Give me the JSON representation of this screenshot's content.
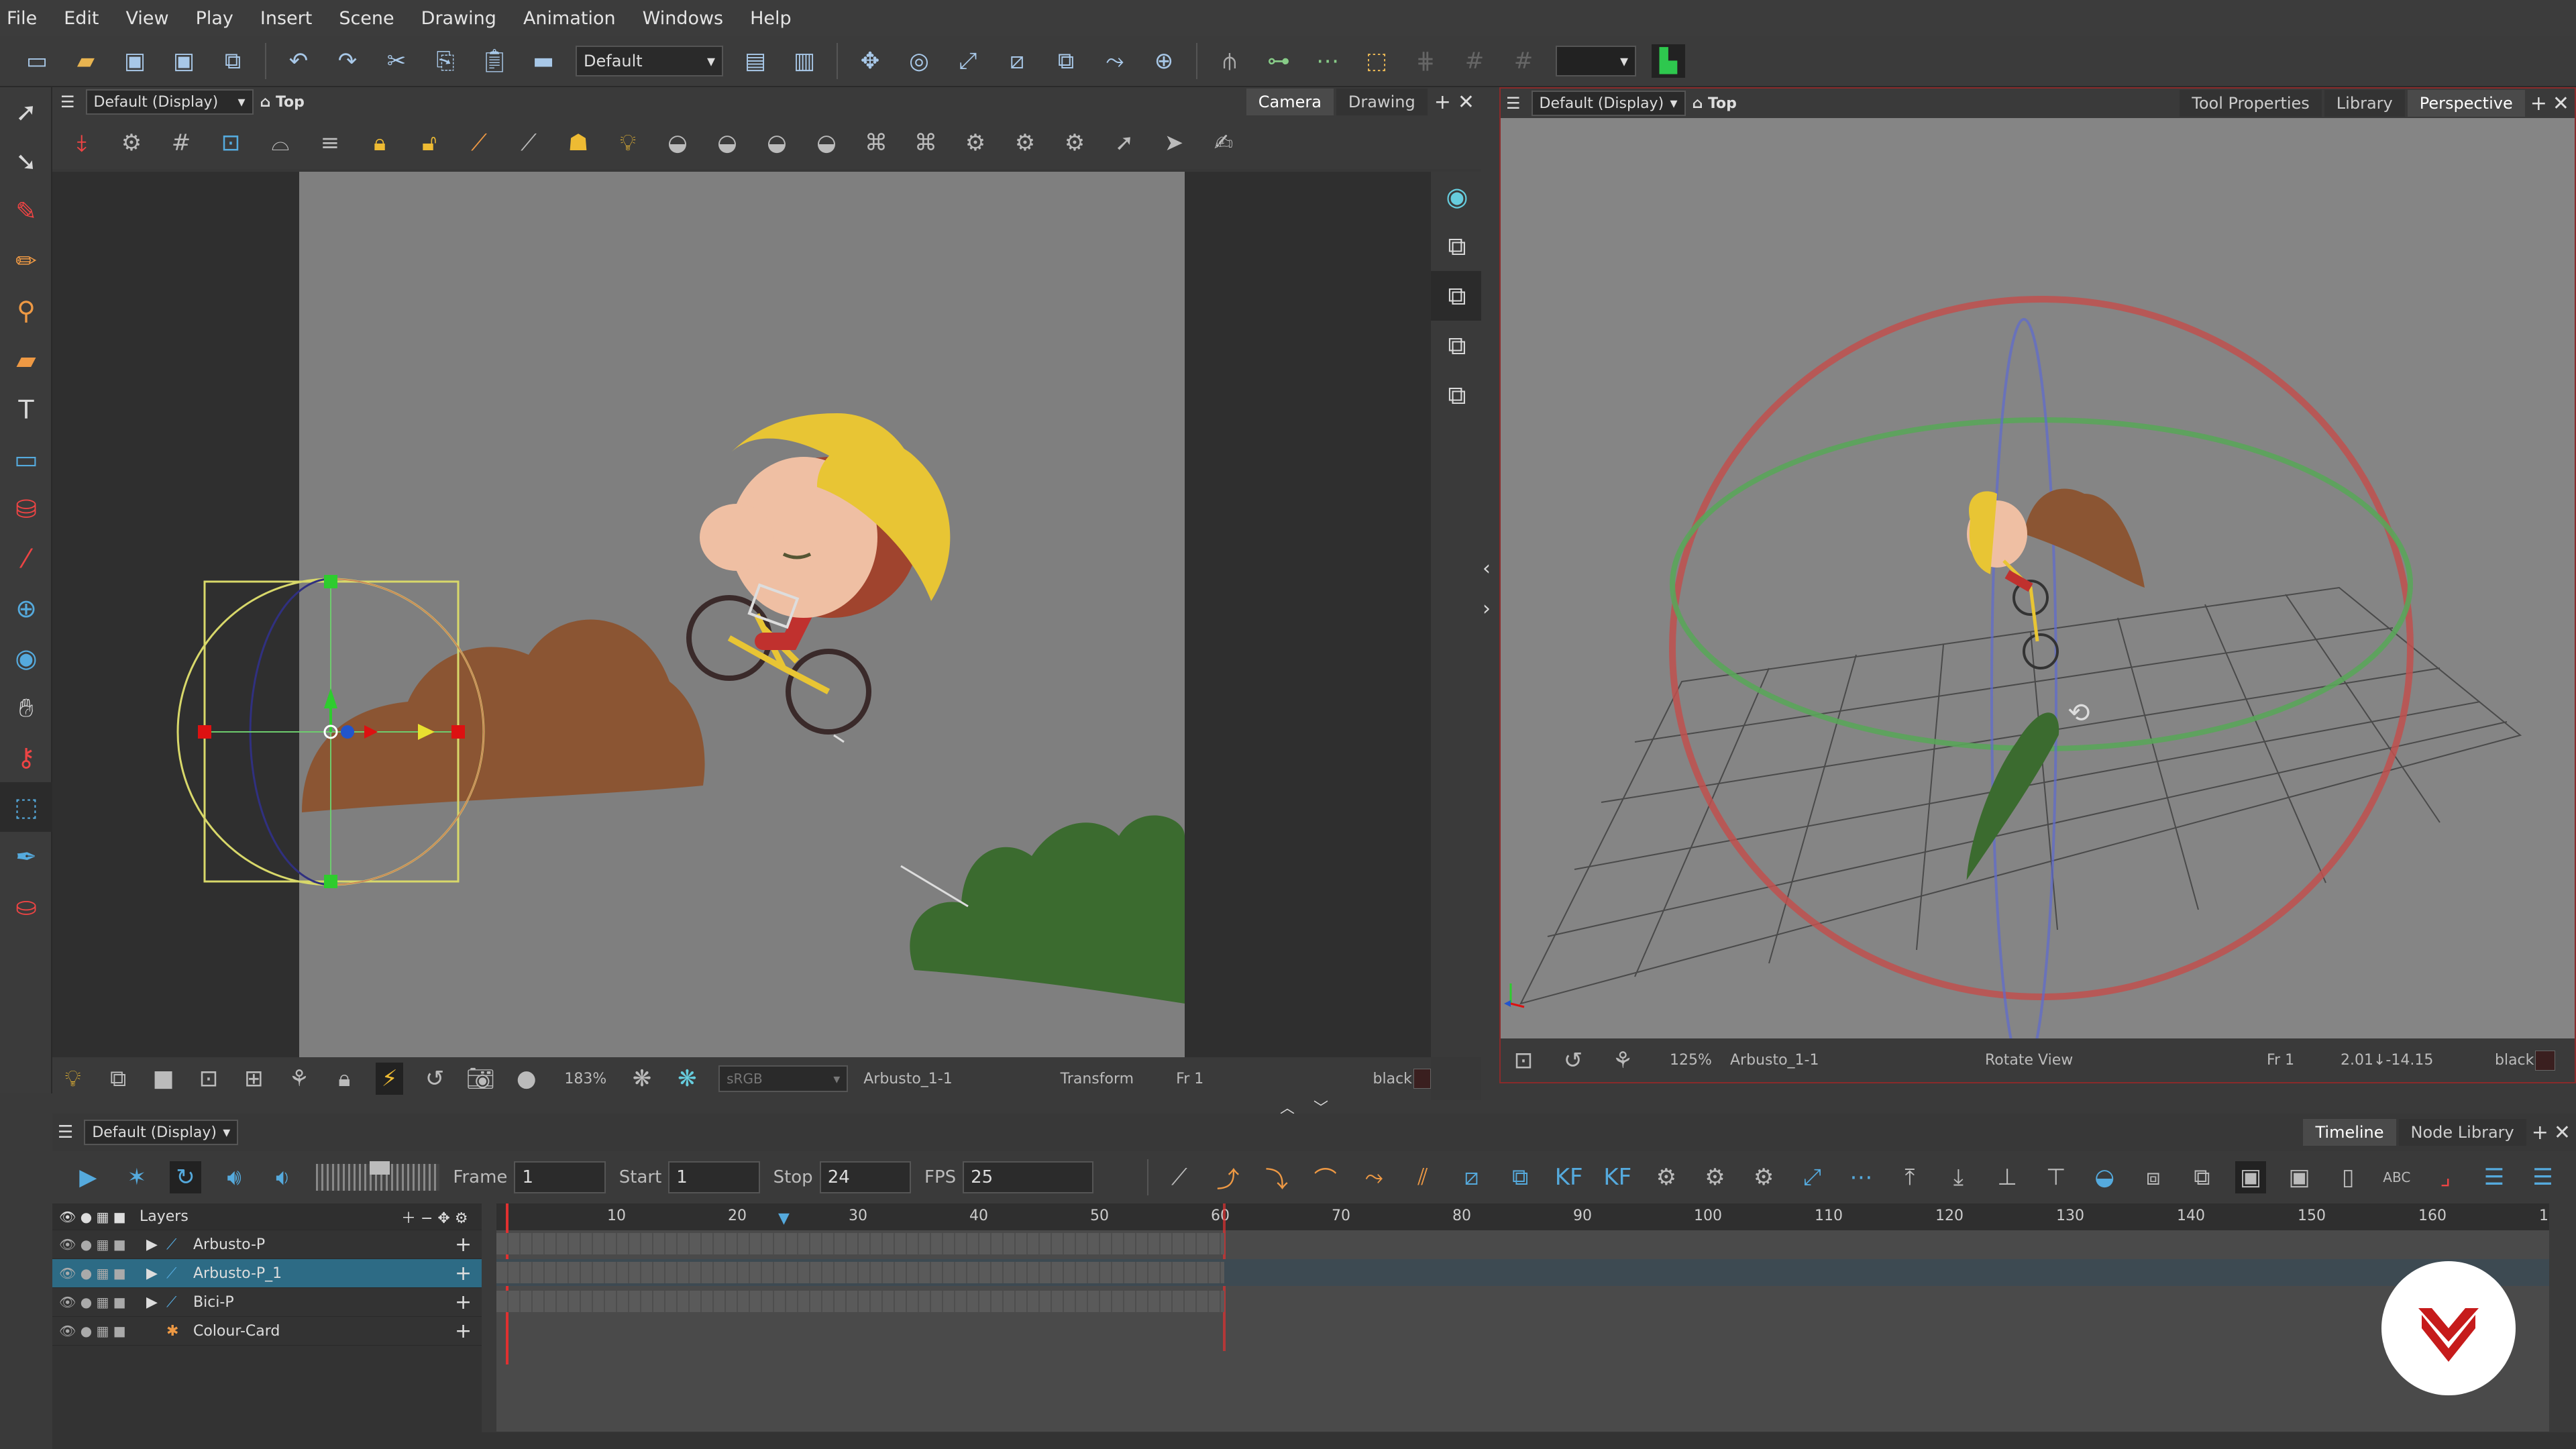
{
  "menu": [
    "File",
    "Edit",
    "View",
    "Play",
    "Insert",
    "Scene",
    "Drawing",
    "Animation",
    "Windows",
    "Help"
  ],
  "toolbar": {
    "workspace_combo": "Default"
  },
  "camera_view": {
    "display_combo": "Default (Display)",
    "view_label": "Top",
    "tabs": [
      "Camera",
      "Drawing"
    ],
    "status": {
      "zoom": "183%",
      "colorspace": "sRGB",
      "drawing": "Arbusto_1-1",
      "tool": "Transform",
      "frame": "Fr 1",
      "color": "black"
    }
  },
  "perspective_view": {
    "display_combo": "Default (Display)",
    "view_label": "Top",
    "tabs": [
      "Tool Properties",
      "Library",
      "Perspective"
    ],
    "status": {
      "zoom": "125%",
      "drawing": "Arbusto_1-1",
      "tool": "Rotate View",
      "frame": "Fr 1",
      "coords": "2.01↓-14.15",
      "color": "black"
    }
  },
  "timeline": {
    "display_combo": "Default (Display)",
    "tabs": [
      "Timeline",
      "Node Library"
    ],
    "frame_label": "Frame",
    "frame": "1",
    "start_label": "Start",
    "start": "1",
    "stop_label": "Stop",
    "stop": "24",
    "fps_label": "FPS",
    "fps": "25",
    "layers_header": "Layers",
    "layers": [
      {
        "name": "Arbusto-P",
        "selected": false
      },
      {
        "name": "Arbusto-P_1",
        "selected": true
      },
      {
        "name": "Bici-P",
        "selected": false
      },
      {
        "name": "Colour-Card",
        "selected": false
      }
    ],
    "ruler": [
      "10",
      "20",
      "30",
      "40",
      "50",
      "60",
      "70",
      "80",
      "90",
      "100",
      "110",
      "120",
      "130",
      "140",
      "150",
      "160",
      "1"
    ]
  },
  "colors": {
    "accent": "#2d6b85",
    "gimbal_red": "#c0504d",
    "gimbal_green": "#5aa55a",
    "bush_brown": "#8b5533",
    "bush_green": "#3b6b2f"
  }
}
